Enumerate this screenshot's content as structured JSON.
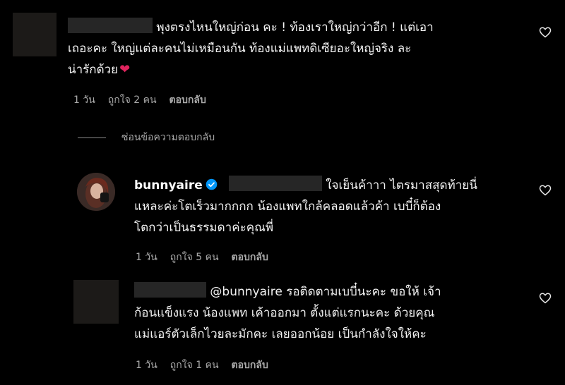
{
  "comments": [
    {
      "text_line1": "พุงตรงไหนใหญ่ก่อน คะ ! ท้องเราใหญ่กว่าอีก ! แต่เอา",
      "text_line2": "เถอะคะ ใหญ่แต่ละคนไม่เหมือนกัน ท้องแม่แพทดิเซียอะใหญ่จริง ละ",
      "text_line3": "น่ารักด้วย",
      "emoji": "❤",
      "time": "1 วัน",
      "likes": "ถูกใจ 2 คน",
      "reply": "ตอบกลับ"
    },
    {
      "username": "bunnyaire",
      "text_line1": "ใจเย็นค้าาา ไตรมาสสุดท้ายนี่",
      "text_line2": "แหละค่ะโตเร็วมากกกก น้องแพทใกล้คลอดแล้วค้า เบบี๋ก็ต้อง",
      "text_line3": "โตกว่าเป็นธรรมดาค่ะคุณพี่",
      "time": "1 วัน",
      "likes": "ถูกใจ 5 คน",
      "reply": "ตอบกลับ"
    },
    {
      "mention": "@bunnyaire",
      "text_line1_rest": " รอติดตามเบบี๋นะคะ ขอให้ เจ้า",
      "text_line2": "ก้อนแข็งแรง น้องแพท เค้าออกมา ตั้งแต่แรกนะคะ ด้วยคุณ",
      "text_line3": "แม่แอร์ตัวเล็กไวยละมักคะ เลยออกน้อย เป็นกำลังใจให้คะ",
      "time": "1 วัน",
      "likes": "ถูกใจ 1 คน",
      "reply": "ตอบกลับ"
    }
  ],
  "hide_replies_label": "ซ่อนข้อความตอบกลับ",
  "icons": {
    "like": "heart-outline-icon",
    "verified": "verified-badge-icon"
  },
  "colors": {
    "background": "#000000",
    "text": "#f2f2f2",
    "muted": "#a8a8a8",
    "verified": "#0095f6",
    "heart_emoji": "#e0245e"
  }
}
